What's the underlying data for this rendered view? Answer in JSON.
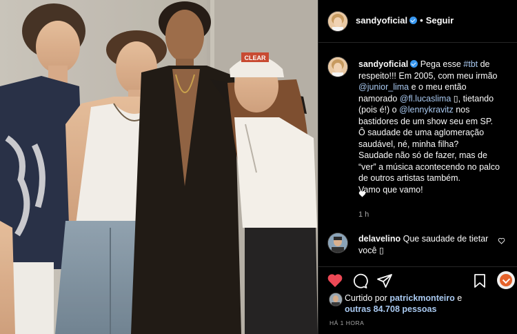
{
  "post": {
    "username": "sandyoficial",
    "follow_label": "Seguir",
    "separator": "•"
  },
  "caption": {
    "username": "sandyoficial",
    "text_1": " Pega esse ",
    "hashtag": "#tbt",
    "text_2": " de respeito!!! Em 2005, com meu irmão ",
    "mention_1": "@junior_lima",
    "text_3": " e o meu então namorado ",
    "mention_2": "@fl.lucaslima",
    "text_4": " ▯, tietando (pois é!) o ",
    "mention_3": "@lennykravitz",
    "text_5": " nos bastidores de um show seu em SP.",
    "line_2": "Ô saudade de uma aglomeração saudável, né, minha filha?",
    "line_3": "Saudade não só de fazer, mas de “ver” a música acontecendo no palco de outros artistas também.",
    "line_4": "Vamo que vamo!",
    "time": "1 h"
  },
  "comment": {
    "username": "delavelino",
    "text": " Que saudade de tietar você ▯"
  },
  "likes": {
    "prefix": "Curtido por ",
    "user": "patrickmonteiro",
    "middle": " e",
    "others": "outras 84.708 pessoas"
  },
  "timestamp": "HÁ 1 HORA",
  "photo": {
    "cap_text": "CLEAR"
  },
  "colors": {
    "background": "#000000",
    "link": "#a9c9f0",
    "like_red": "#ed4956",
    "verified": "#3897f0"
  },
  "icons": [
    "verified-icon",
    "heart-icon",
    "comment-icon",
    "share-icon",
    "bookmark-icon",
    "download-icon"
  ]
}
